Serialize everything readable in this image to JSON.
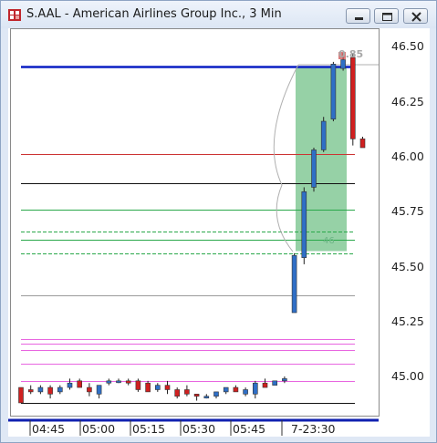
{
  "window": {
    "title": "S.AAL - American Airlines Group Inc., 3 Min",
    "icons": [
      "app-logo-icon",
      "minimize-icon",
      "restore-icon",
      "close-icon"
    ]
  },
  "price_axis": {
    "labels": [
      "46.50",
      "46.25",
      "46.00",
      "45.75",
      "45.50",
      "45.25",
      "45.00"
    ]
  },
  "time_axis": {
    "labels": [
      "04:45",
      "05:00",
      "05:15",
      "05:30",
      "05:45",
      "7-23:30"
    ]
  },
  "annotations": {
    "change_label": "0.85",
    "zone_label": "46"
  },
  "colors": {
    "up_candle": "#2f6fc6",
    "down_candle": "#d02020",
    "zone_fill": "#7cc690",
    "level_blue": "#0a1fc4",
    "level_red": "#cc3333",
    "level_green": "#2aa84a",
    "level_pink": "#e866e0"
  },
  "chart_data": {
    "type": "candlestick",
    "symbol": "S.AAL",
    "interval": "3 Min",
    "y_range": [
      44.88,
      46.55
    ],
    "y_ticks": [
      45.0,
      45.25,
      45.5,
      45.75,
      46.0,
      46.25,
      46.5
    ],
    "x_ticks": [
      "04:45",
      "05:00",
      "05:15",
      "05:30",
      "05:45",
      "7-23:30"
    ],
    "candles": [
      {
        "o": 44.95,
        "h": 44.95,
        "l": 44.88,
        "c": 44.88
      },
      {
        "o": 44.94,
        "h": 44.96,
        "l": 44.92,
        "c": 44.93
      },
      {
        "o": 44.93,
        "h": 44.96,
        "l": 44.92,
        "c": 44.95
      },
      {
        "o": 44.95,
        "h": 44.96,
        "l": 44.9,
        "c": 44.92
      },
      {
        "o": 44.93,
        "h": 44.96,
        "l": 44.92,
        "c": 44.95
      },
      {
        "o": 44.95,
        "h": 44.99,
        "l": 44.94,
        "c": 44.97
      },
      {
        "o": 44.98,
        "h": 44.99,
        "l": 44.96,
        "c": 44.95
      },
      {
        "o": 44.95,
        "h": 44.97,
        "l": 44.91,
        "c": 44.93
      },
      {
        "o": 44.92,
        "h": 44.96,
        "l": 44.9,
        "c": 44.96
      },
      {
        "o": 44.97,
        "h": 44.99,
        "l": 44.96,
        "c": 44.98
      },
      {
        "o": 44.98,
        "h": 44.99,
        "l": 44.97,
        "c": 44.98
      },
      {
        "o": 44.98,
        "h": 44.99,
        "l": 44.96,
        "c": 44.97
      },
      {
        "o": 44.98,
        "h": 44.99,
        "l": 44.93,
        "c": 44.94
      },
      {
        "o": 44.97,
        "h": 44.98,
        "l": 44.93,
        "c": 44.93
      },
      {
        "o": 44.94,
        "h": 44.97,
        "l": 44.93,
        "c": 44.96
      },
      {
        "o": 44.96,
        "h": 44.98,
        "l": 44.92,
        "c": 44.94
      },
      {
        "o": 44.94,
        "h": 44.95,
        "l": 44.9,
        "c": 44.91
      },
      {
        "o": 44.94,
        "h": 44.96,
        "l": 44.91,
        "c": 44.92
      },
      {
        "o": 44.92,
        "h": 44.92,
        "l": 44.89,
        "c": 44.91
      },
      {
        "o": 44.91,
        "h": 44.92,
        "l": 44.9,
        "c": 44.91
      },
      {
        "o": 44.91,
        "h": 44.93,
        "l": 44.9,
        "c": 44.93
      },
      {
        "o": 44.93,
        "h": 44.95,
        "l": 44.92,
        "c": 44.95
      },
      {
        "o": 44.95,
        "h": 44.96,
        "l": 44.93,
        "c": 44.93
      },
      {
        "o": 44.92,
        "h": 44.95,
        "l": 44.91,
        "c": 44.94
      },
      {
        "o": 44.92,
        "h": 44.98,
        "l": 44.9,
        "c": 44.97
      },
      {
        "o": 44.97,
        "h": 44.99,
        "l": 44.95,
        "c": 44.95
      },
      {
        "o": 44.96,
        "h": 44.98,
        "l": 44.96,
        "c": 44.98
      },
      {
        "o": 44.98,
        "h": 45.0,
        "l": 44.97,
        "c": 44.99
      },
      {
        "o": 45.29,
        "h": 45.56,
        "l": 45.29,
        "c": 45.55
      },
      {
        "o": 45.54,
        "h": 45.86,
        "l": 45.51,
        "c": 45.84
      },
      {
        "o": 45.86,
        "h": 46.04,
        "l": 45.84,
        "c": 46.03
      },
      {
        "o": 46.03,
        "h": 46.18,
        "l": 46.02,
        "c": 46.16
      },
      {
        "o": 46.17,
        "h": 46.43,
        "l": 46.16,
        "c": 46.42
      },
      {
        "o": 46.4,
        "h": 46.47,
        "l": 46.39,
        "c": 46.44
      },
      {
        "o": 46.45,
        "h": 46.47,
        "l": 46.05,
        "c": 46.08
      },
      {
        "o": 46.08,
        "h": 46.09,
        "l": 46.04,
        "c": 46.04
      }
    ],
    "levels": [
      {
        "price": 46.41,
        "color": "blue"
      },
      {
        "price": 46.01,
        "color": "red"
      },
      {
        "price": 45.88,
        "color": "black"
      },
      {
        "price": 45.76,
        "color": "green"
      },
      {
        "price": 45.66,
        "color": "green"
      },
      {
        "price": 45.62,
        "color": "green"
      },
      {
        "price": 45.56,
        "color": "green"
      },
      {
        "price": 45.37,
        "color": "gray"
      },
      {
        "price": 45.17,
        "color": "pink"
      },
      {
        "price": 45.15,
        "color": "pink"
      },
      {
        "price": 45.12,
        "color": "pink"
      },
      {
        "price": 45.06,
        "color": "pink"
      },
      {
        "price": 44.98,
        "color": "pink"
      },
      {
        "price": 44.88,
        "color": "black"
      }
    ],
    "zone": {
      "top": 46.41,
      "bottom": 45.57
    }
  }
}
